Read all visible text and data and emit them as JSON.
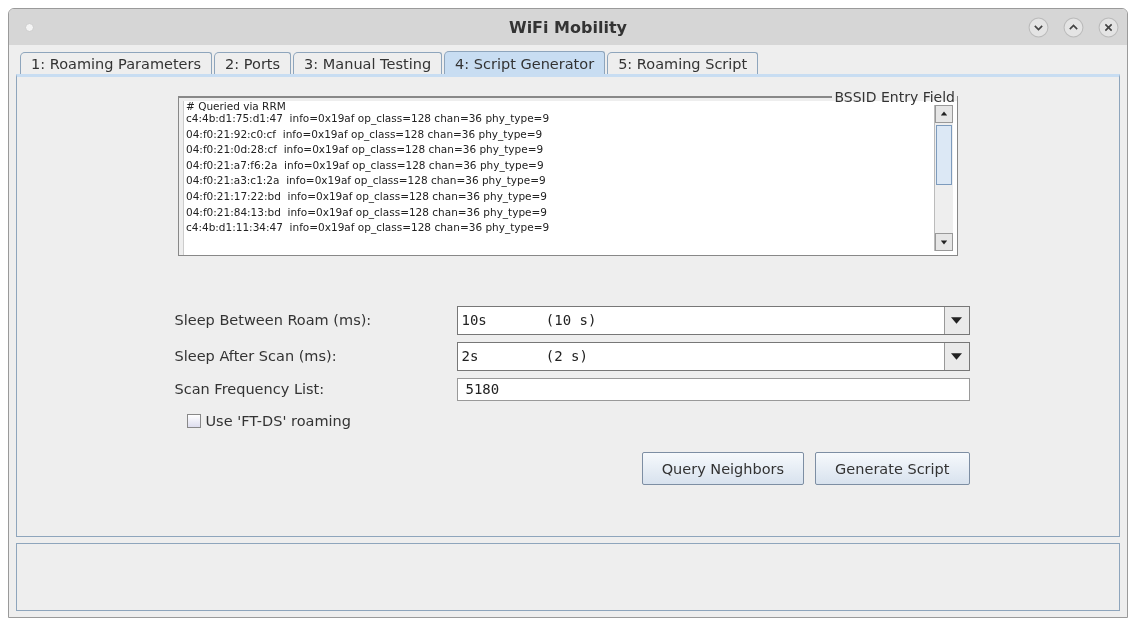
{
  "window": {
    "title": "WiFi Mobility"
  },
  "tabs": [
    {
      "label": "1: Roaming Parameters",
      "selected": false
    },
    {
      "label": "2: Ports",
      "selected": false
    },
    {
      "label": "3: Manual Testing",
      "selected": false
    },
    {
      "label": "4: Script Generator",
      "selected": true
    },
    {
      "label": "5: Roaming Script",
      "selected": false
    }
  ],
  "bssid_field": {
    "title": "BSSID Entry Field",
    "lines": [
      "# Queried via RRM",
      "c4:4b:d1:75:d1:47  info=0x19af op_class=128 chan=36 phy_type=9",
      "04:f0:21:92:c0:cf  info=0x19af op_class=128 chan=36 phy_type=9",
      "04:f0:21:0d:28:cf  info=0x19af op_class=128 chan=36 phy_type=9",
      "04:f0:21:a7:f6:2a  info=0x19af op_class=128 chan=36 phy_type=9",
      "04:f0:21:a3:c1:2a  info=0x19af op_class=128 chan=36 phy_type=9",
      "04:f0:21:17:22:bd  info=0x19af op_class=128 chan=36 phy_type=9",
      "04:f0:21:84:13:bd  info=0x19af op_class=128 chan=36 phy_type=9",
      "c4:4b:d1:11:34:47  info=0x19af op_class=128 chan=36 phy_type=9"
    ]
  },
  "form": [
    {
      "kind": "dropdown",
      "label": "Sleep Between Roam (ms):",
      "value": "10s       (10 s)"
    },
    {
      "kind": "dropdown",
      "label": "Sleep After Scan (ms):",
      "value": "2s        (2 s)"
    },
    {
      "kind": "text",
      "label": "Scan Frequency List:",
      "value": "5180"
    }
  ],
  "ft_ds": {
    "label": "Use 'FT-DS' roaming",
    "checked": false
  },
  "buttons": [
    "Query Neighbors",
    "Generate Script"
  ]
}
